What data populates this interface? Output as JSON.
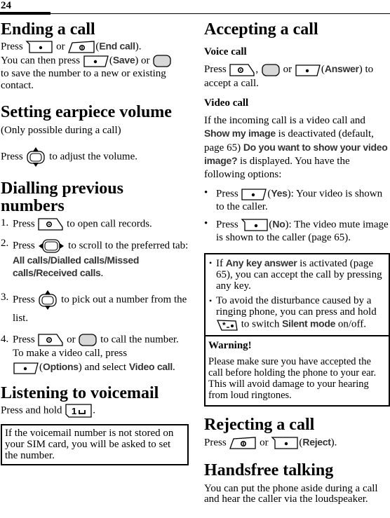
{
  "page": {
    "number": "24"
  },
  "left": {
    "ending": {
      "title": "Ending a call",
      "l1_a": "Press ",
      "l1_b": " or ",
      "l1_c": "(",
      "l1_ui": "End call",
      "l1_d": ").",
      "l2_a": "You can then press ",
      "l2_b": "(",
      "l2_ui": "Save",
      "l2_c": ") or ",
      "l3": "to save the number to a new or existing contact."
    },
    "volume": {
      "title": "Setting earpiece volume",
      "note": "(Only possible during a call)",
      "l1_a": "Press ",
      "l1_b": " to adjust the volume."
    },
    "dialling": {
      "title": "Dialling previous numbers",
      "steps": [
        {
          "num": "1.",
          "a": "Press ",
          "b": " to open call records."
        },
        {
          "num": "2.",
          "a": "Press ",
          "b": " to scroll to the preferred tab: ",
          "ui": "All calls/Dialled calls/Missed calls/Received calls",
          "c": "."
        },
        {
          "num": "3.",
          "a": "Press ",
          "b": " to pick out a number from the list."
        },
        {
          "num": "4.",
          "a": "Press ",
          "b": " or ",
          "c": " to call the number.",
          "d": "To make a video call, press",
          "e": "(",
          "ui1": "Options",
          "f": ") and select ",
          "ui2": "Video call",
          "g": "."
        }
      ]
    },
    "voicemail": {
      "title": "Listening to voicemail",
      "l1_a": "Press and hold ",
      "l1_b": ".",
      "box": "If the voicemail number is not stored on your SIM card, you will be asked to set the number."
    }
  },
  "right": {
    "accepting": {
      "title": "Accepting a call",
      "voice_title": "Voice call",
      "v_a": "Press ",
      "v_b": ", ",
      "v_c": " or ",
      "v_d": "(",
      "v_ui": "Answer",
      "v_e": ") to accept a call.",
      "video_title": "Video call",
      "vid_a": "If the incoming call is a video call and ",
      "vid_ui1": "Show my image",
      "vid_b": " is deactivated (default, page 65) ",
      "vid_ui2": "Do you want to show your video image?",
      "vid_c": " is displayed. You have the following options:",
      "options": [
        {
          "bullet": "•",
          "a": "Press ",
          "b": "(",
          "ui": "Yes",
          "c": "): Your video is shown to the caller."
        },
        {
          "bullet": "•",
          "a": "Press ",
          "b": "(",
          "ui": "No",
          "c": "): The video mute image is shown to the caller (page 65)."
        }
      ],
      "tips": [
        {
          "bullet": "•",
          "a": "If ",
          "ui": "Any key answer",
          "b": " is activated (page 65), you can accept the call by pressing any key."
        },
        {
          "bullet": "•",
          "a": "To avoid the disturbance caused by a ringing phone, you can press and hold ",
          "b": " to switch ",
          "ui": "Silent mode",
          "c": " on/off."
        }
      ],
      "warning_title": "Warning!",
      "warning_text": "Please make sure you have accepted the call before holding the phone to your ear. This will avoid damage to your hearing from loud ringtones."
    },
    "rejecting": {
      "title": "Rejecting a call",
      "a": "Press ",
      "b": " or ",
      "c": "(",
      "ui": "Reject",
      "d": ")."
    },
    "handsfree": {
      "title": "Handsfree talking",
      "text": "You can put the phone aside during a call and hear the caller via the loudspeaker."
    }
  },
  "icons": {
    "left_softkey": "left-softkey-icon",
    "right_softkey": "right-softkey-icon",
    "end_key": "end-call-key-icon",
    "call_key": "call-key-icon",
    "side_key": "round-side-key-icon",
    "nav_updown": "nav-key-up-down-icon",
    "nav_leftright": "nav-key-left-right-icon",
    "key_1": "voicemail-key-1-icon",
    "key_star": "star-key-icon"
  }
}
